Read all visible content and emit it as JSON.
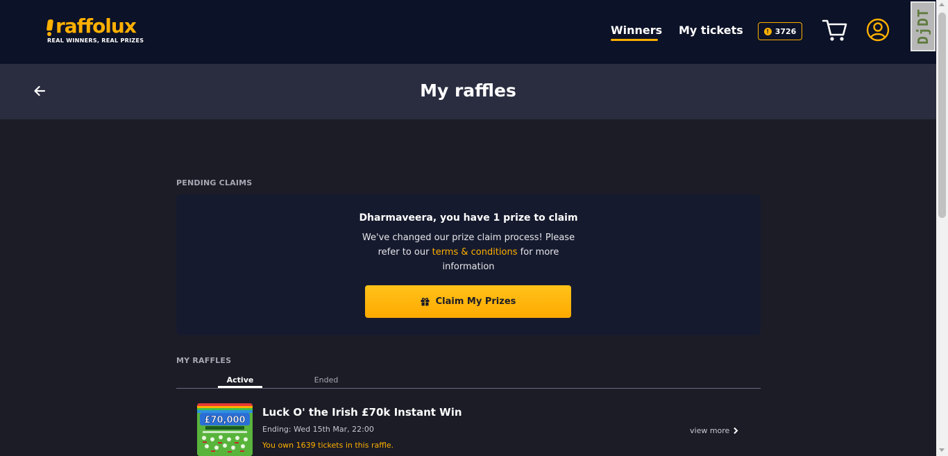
{
  "brand": {
    "name": "raffolux",
    "tagline": "REAL WINNERS, REAL PRIZES",
    "accent": "#ffb000"
  },
  "nav": {
    "winners": "Winners",
    "my_tickets": "My tickets",
    "credits": "3726",
    "coin_symbol": "!",
    "cart_icon": "cart-icon",
    "account_icon": "user-circle-icon",
    "debug_toolbar": "DjDT"
  },
  "page": {
    "title": "My raffles",
    "back_icon": "arrow-left-icon"
  },
  "pending": {
    "label": "PENDING CLAIMS",
    "title": "Dharmaveera, you have 1 prize to claim",
    "desc_before": "We've changed our prize claim process! Please refer to our ",
    "terms_link": "terms & conditions",
    "desc_after": " for more information",
    "button": "Claim My Prizes",
    "button_icon": "gift-icon"
  },
  "raffles": {
    "label": "MY RAFFLES",
    "tabs": [
      "Active",
      "Ended"
    ],
    "active_tab": "Active",
    "items": [
      {
        "title": "Luck O' the Irish £70k Instant Win",
        "ending": "Ending: Wed 15th Mar, 22:00",
        "owned": "You own 1639 tickets in this raffle.",
        "view_more": "view more",
        "thumb_text": "£70,000"
      }
    ]
  }
}
